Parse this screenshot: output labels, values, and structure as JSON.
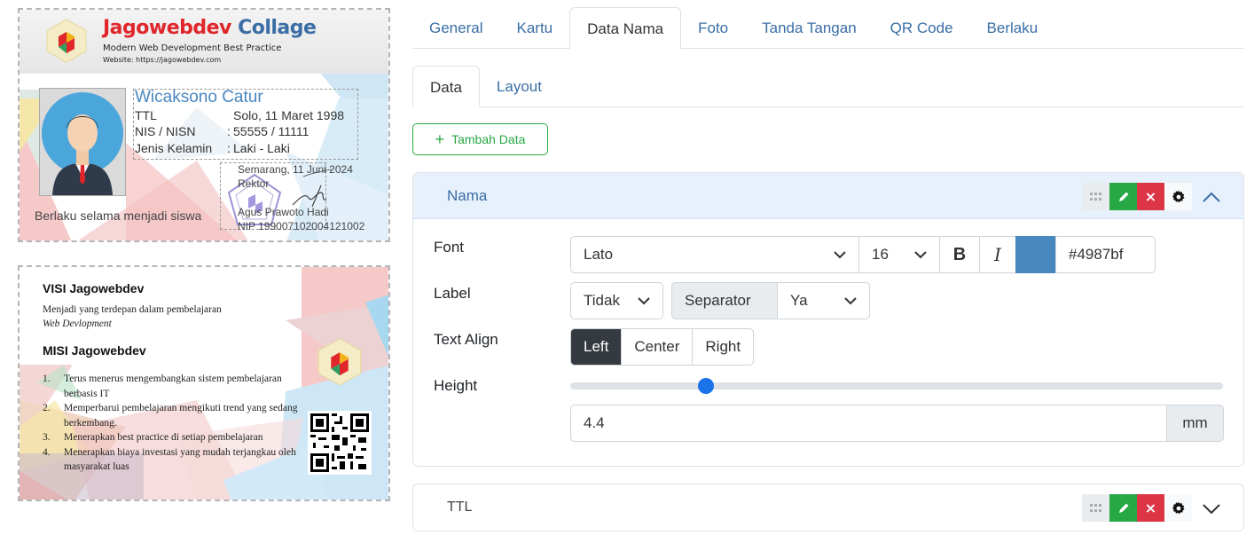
{
  "card_front": {
    "brand_part1": "Jagowebdev",
    "brand_part2": "Collage",
    "tagline": "Modern Web Development Best Practice",
    "website": "Website: https://jagowebdev.com",
    "name": "Wicaksono Catur",
    "rows": [
      {
        "label": "TTL",
        "sep": "",
        "value": "Solo, 11 Maret 1998"
      },
      {
        "label": "NIS / NISN",
        "sep": ":",
        "value": "55555 / 11111"
      },
      {
        "label": "Jenis Kelamin",
        "sep": ":",
        "value": "Laki - Laki"
      }
    ],
    "sign_date": "Semarang, 11 Juni 2024",
    "sign_role": "Rektor",
    "sign_name": "Agus Prawoto Hadi",
    "sign_nip": "NIP 199007102004121002",
    "validity": "Berlaku selama menjadi siswa",
    "colors": {
      "name": "#4987bf",
      "brand_red": "#e0262b",
      "brand_blue": "#3a6ea5"
    }
  },
  "card_back": {
    "visi_title": "VISI Jagowebdev",
    "visi_line1": "Menjadi yang terdepan dalam pembelajaran",
    "visi_line2": "Web Devlopment",
    "misi_title": "MISI Jagowebdev",
    "misi": [
      {
        "num": "1.",
        "text": "Terus menerus mengembangkan sistem pembelajaran berbasis IT"
      },
      {
        "num": "2.",
        "text": "Memperbarui pembelajaran mengikuti trend yang sedang berkembang."
      },
      {
        "num": "3.",
        "text": "Menerapkan best practice di setiap pembelajaran"
      },
      {
        "num": "4.",
        "text": "Menerapkan biaya investasi yang mudah terjangkau oleh masyarakat luas"
      }
    ]
  },
  "tabs": {
    "main": [
      "General",
      "Kartu",
      "Data Nama",
      "Foto",
      "Tanda Tangan",
      "QR Code",
      "Berlaku"
    ],
    "main_active": "Data Nama",
    "sub": [
      "Data",
      "Layout"
    ],
    "sub_active": "Data"
  },
  "add_button": "Tambah Data",
  "panels": {
    "nama": {
      "title": "Nama",
      "labels": {
        "font": "Font",
        "label": "Label",
        "align": "Text Align",
        "height": "Height"
      },
      "font_family": "Lato",
      "font_size": "16",
      "bold": "B",
      "italic": "I",
      "color_hex": "#4987bf",
      "label_value": "Tidak",
      "separator_label": "Separator",
      "separator_value": "Ya",
      "align_options": [
        "Left",
        "Center",
        "Right"
      ],
      "align_selected": "Left",
      "height_value": "4.4",
      "height_unit": "mm",
      "height_slider_fraction": 0.208
    },
    "ttl": {
      "title": "TTL"
    }
  },
  "icons": {
    "drag": "grid-icon",
    "edit": "pencil-icon",
    "delete": "close-icon",
    "settings": "gear-icon",
    "collapse": "chevron-up-icon",
    "expand": "chevron-down-icon",
    "add": "plus-icon"
  }
}
